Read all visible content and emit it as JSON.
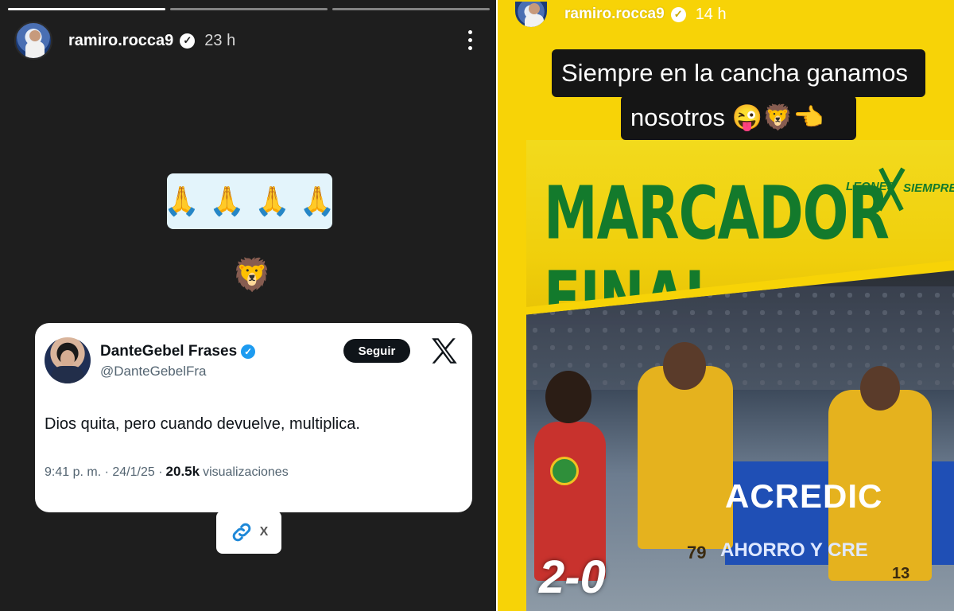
{
  "left_story": {
    "username": "ramiro.rocca9",
    "time": "23 h",
    "pray_emojis": [
      "🙏",
      "🙏",
      "🙏",
      "🙏"
    ],
    "lion_emoji": "🦁",
    "tweet": {
      "name": "DanteGebel Frases",
      "handle": "@DanteGebelFra",
      "follow_label": "Seguir",
      "text": "Dios quita, pero cuando devuelve, multiplica.",
      "time_date": "9:41 p. m. · 24/1/25 ·",
      "views_count": "20.5k",
      "views_label": "visualizaciones"
    },
    "link_sticker_label": "X"
  },
  "right_story": {
    "username": "ramiro.rocca9",
    "time": "14 h",
    "caption_line1": "Siempre en la cancha ganamos",
    "caption_line2": "nosotros 😜🦁👈",
    "banner_title": "MARCADOR FINAL",
    "logo_text_left": "LEONES",
    "logo_text_right": "SIEMPRE",
    "ad_text": "ACREDIC",
    "ad_sub": "AHORRO Y CRE",
    "score": "2-0",
    "jersey_number_1": "79",
    "jersey_number_2": "13"
  },
  "colors": {
    "left_bg": "#1e1e1e",
    "right_bg": "#f7d307",
    "banner_green": "#137a2c",
    "verified_blue": "#1d9bf0"
  }
}
